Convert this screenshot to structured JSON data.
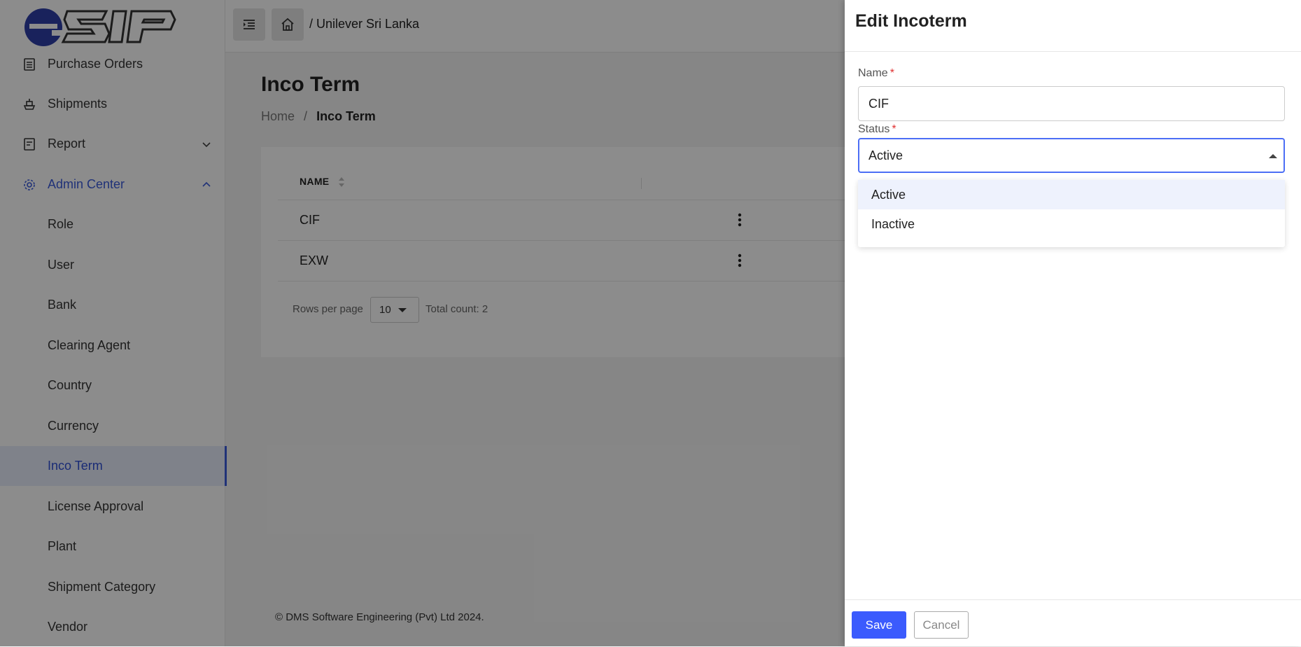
{
  "app": {
    "logo_text": "eSIP"
  },
  "sidebar": {
    "items": [
      {
        "label": "Purchase Orders",
        "icon": "list-icon"
      },
      {
        "label": "Shipments",
        "icon": "ship-icon"
      },
      {
        "label": "Report",
        "icon": "report-icon",
        "expandable": true
      },
      {
        "label": "Admin Center",
        "icon": "gear-icon",
        "expanded": true
      },
      {
        "label": "Role"
      },
      {
        "label": "User"
      },
      {
        "label": "Bank"
      },
      {
        "label": "Clearing Agent"
      },
      {
        "label": "Country"
      },
      {
        "label": "Currency"
      },
      {
        "label": "Inco Term",
        "active": true
      },
      {
        "label": "License Approval"
      },
      {
        "label": "Plant"
      },
      {
        "label": "Shipment Category"
      },
      {
        "label": "Vendor"
      }
    ]
  },
  "topbar": {
    "company": "/ Unilever Sri Lanka"
  },
  "page": {
    "title": "Inco Term",
    "breadcrumb_home": "Home",
    "breadcrumb_sep": "/",
    "breadcrumb_current": "Inco Term"
  },
  "table": {
    "header_name": "NAME",
    "rows": [
      {
        "name": "CIF"
      },
      {
        "name": "EXW"
      }
    ],
    "rows_per_page_label": "Rows per page",
    "rows_per_page_value": "10",
    "total_count": "Total count: 2"
  },
  "footer": {
    "copyright": "© DMS Software Engineering (Pvt) Ltd 2024."
  },
  "drawer": {
    "title": "Edit Incoterm",
    "name_label": "Name",
    "name_value": "CIF",
    "status_label": "Status",
    "status_value": "Active",
    "required_mark": "*",
    "status_options": [
      "Active",
      "Inactive"
    ],
    "save_label": "Save",
    "cancel_label": "Cancel"
  },
  "colors": {
    "accent": "#3b5bfd",
    "required": "#e03131"
  }
}
